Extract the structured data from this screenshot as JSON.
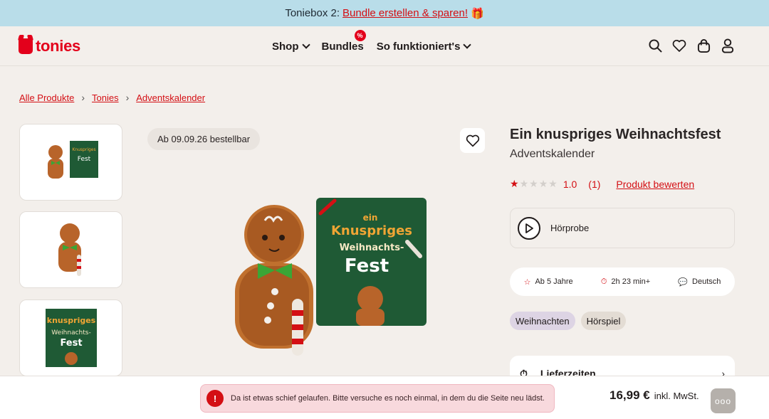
{
  "promo": {
    "prefix": "Toniebox 2: ",
    "link": "Bundle erstellen & sparen!",
    "gift_icon": "gift-icon"
  },
  "brand": {
    "name": "tonies",
    "color": "#e3001b"
  },
  "nav": {
    "shop": "Shop",
    "bundles": "Bundles",
    "bundles_badge": "%",
    "how": "So funktioniert's"
  },
  "header_icons": [
    "search-icon",
    "heart-icon",
    "bag-icon",
    "user-icon"
  ],
  "breadcrumb": [
    "Alle Produkte",
    "Tonies",
    "Adventskalender"
  ],
  "gallery": {
    "availability": "Ab 09.09.26 bestellbar",
    "thumbs": [
      "figure-and-cover",
      "figure",
      "cover"
    ],
    "cover_text": {
      "line1": "ein",
      "line2": "Knuspriges",
      "line3": "Weihnachts-",
      "line4": "Fest"
    }
  },
  "product": {
    "title": "Ein knuspriges Weihnachtsfest",
    "subtitle": "Adventskalender",
    "rating_value": "1.0",
    "rating_stars": 1,
    "rating_count": "(1)",
    "rate_link": "Produkt bewerten",
    "audio_label": "Hörprobe",
    "meta": {
      "age": "Ab 5 Jahre",
      "duration": "2h 23 min+",
      "language": "Deutsch"
    },
    "tags": [
      "Weihnachten",
      "Hörspiel"
    ],
    "delivery": "Lieferzeiten"
  },
  "purchase": {
    "price": "16,99 €",
    "vat": "inkl. MwSt.",
    "more": "ooo"
  },
  "toast": {
    "icon": "!",
    "message": "Da ist etwas schief gelaufen. Bitte versuche es noch einmal, in dem du die Seite neu lädst."
  }
}
